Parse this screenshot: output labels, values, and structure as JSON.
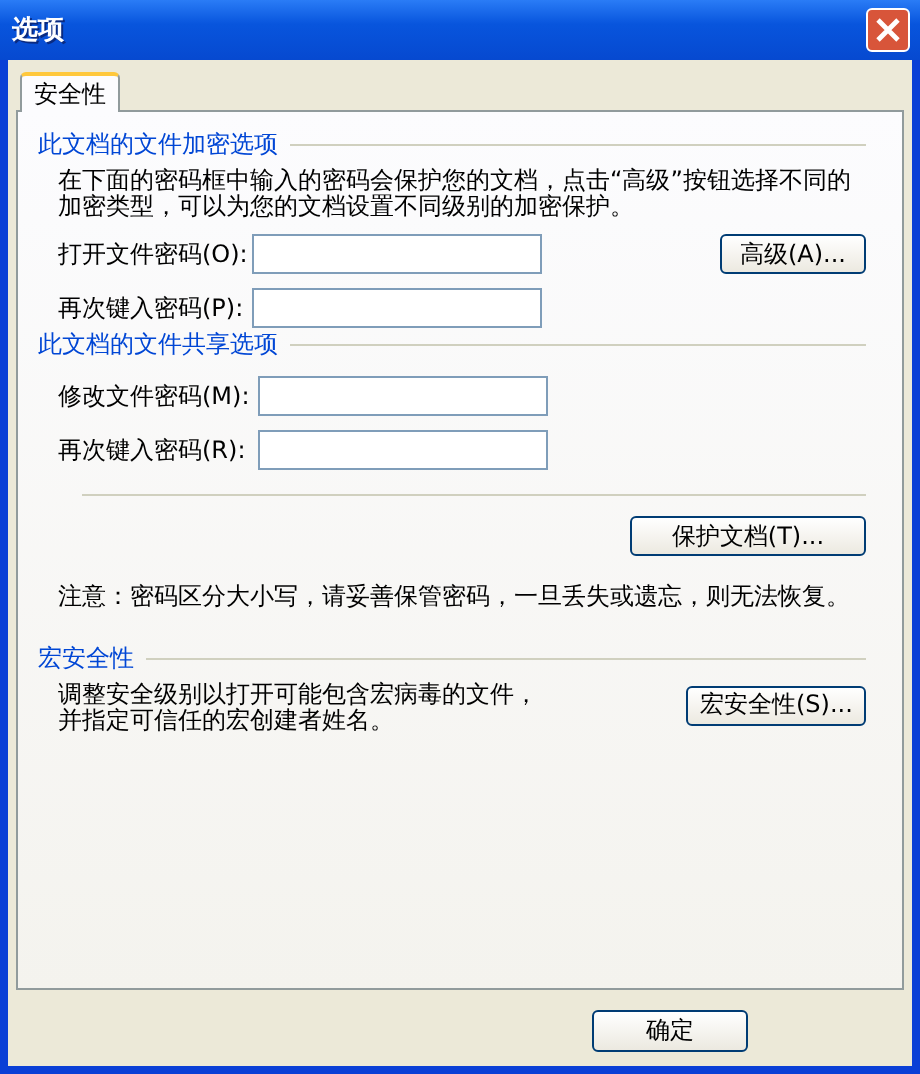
{
  "window": {
    "title": "选项"
  },
  "tabs": [
    {
      "label": "安全性",
      "selected": true
    }
  ],
  "sections": [
    {
      "title": "此文档的文件加密选项",
      "description": "在下面的密码框中输入的密码会保护您的文档，点击“高级”按钮选择不同的加密类型，可以为您的文档设置不同级别的加密保护。",
      "fields": [
        {
          "label": "打开文件密码(O):",
          "button": "高级(A)..."
        },
        {
          "label": "再次键入密码(P):"
        }
      ]
    },
    {
      "title": "此文档的文件共享选项",
      "fields": [
        {
          "label": "修改文件密码(M):"
        },
        {
          "label": "再次键入密码(R):"
        }
      ],
      "action": "保护文档(T)...",
      "note": "注意：密码区分大小写，请妥善保管密码，一旦丢失或遗忘，则无法恢复。"
    },
    {
      "title": "宏安全性",
      "description": "调整安全级别以打开可能包含宏病毒的文件，并指定可信任的宏创建者姓名。",
      "side_button": "宏安全性(S)..."
    }
  ],
  "buttons": [
    "确定"
  ]
}
